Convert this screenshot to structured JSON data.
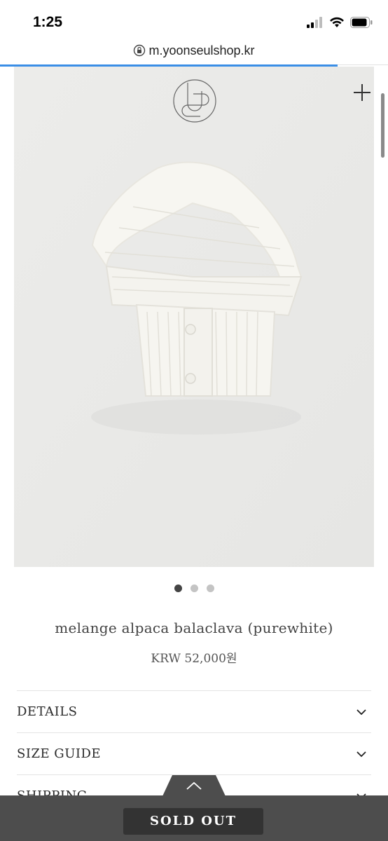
{
  "status_bar": {
    "time": "1:25"
  },
  "browser": {
    "url": "m.yoonseulshop.kr"
  },
  "product": {
    "name": "melange alpaca balaclava (purewhite)",
    "price": "KRW 52,000원",
    "image_count": 3,
    "active_image": 1
  },
  "accordion": [
    {
      "label": "DETAILS"
    },
    {
      "label": "SIZE GUIDE"
    },
    {
      "label": "SHIPPING"
    }
  ],
  "action": {
    "sold_out_label": "SOLD OUT"
  },
  "icons": [
    "signal-icon",
    "wifi-icon",
    "battery-icon",
    "lock-icon",
    "brand-logo",
    "plus-icon",
    "chevron-down-icon",
    "chevron-up-icon"
  ]
}
